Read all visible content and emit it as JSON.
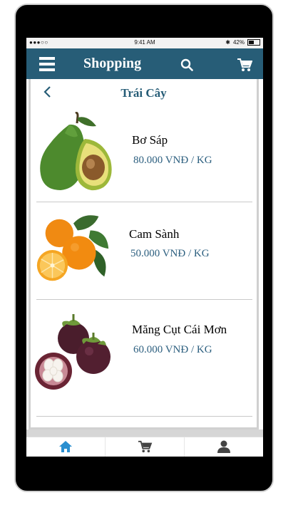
{
  "status_bar": {
    "signal": "●●●○○",
    "time": "9:41 AM",
    "battery": "42%"
  },
  "header": {
    "title": "Shopping"
  },
  "page": {
    "title": "Trái Cây"
  },
  "products": [
    {
      "name": "Bơ Sáp",
      "price": "80.000 VNĐ / KG"
    },
    {
      "name": "Cam Sành",
      "price": "50.000 VNĐ / KG"
    },
    {
      "name": "Măng Cụt Cái Mơn",
      "price": "60.000 VNĐ / KG"
    }
  ],
  "tabs": [
    {
      "icon": "home-icon",
      "color": "#2a8fd0"
    },
    {
      "icon": "cart-icon",
      "color": "#444444"
    },
    {
      "icon": "user-icon",
      "color": "#444444"
    }
  ],
  "colors": {
    "header": "#275d77",
    "price": "#2c5f7f"
  }
}
